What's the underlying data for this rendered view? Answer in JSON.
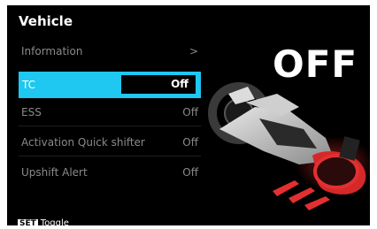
{
  "title": "Vehicle",
  "menu": [
    {
      "label": "Information",
      "value": ">"
    },
    {
      "label": "TC",
      "value": "Off"
    },
    {
      "label": "ESS",
      "value": "Off"
    },
    {
      "label": "Activation Quick shifter",
      "value": "Off"
    },
    {
      "label": "Upshift Alert",
      "value": "Off"
    }
  ],
  "status_big": "OFF",
  "footer": {
    "key": "SET",
    "action": "Toggle"
  },
  "colors": {
    "accent": "#1ec8f0",
    "background": "#000000",
    "warning": "#e23030"
  }
}
